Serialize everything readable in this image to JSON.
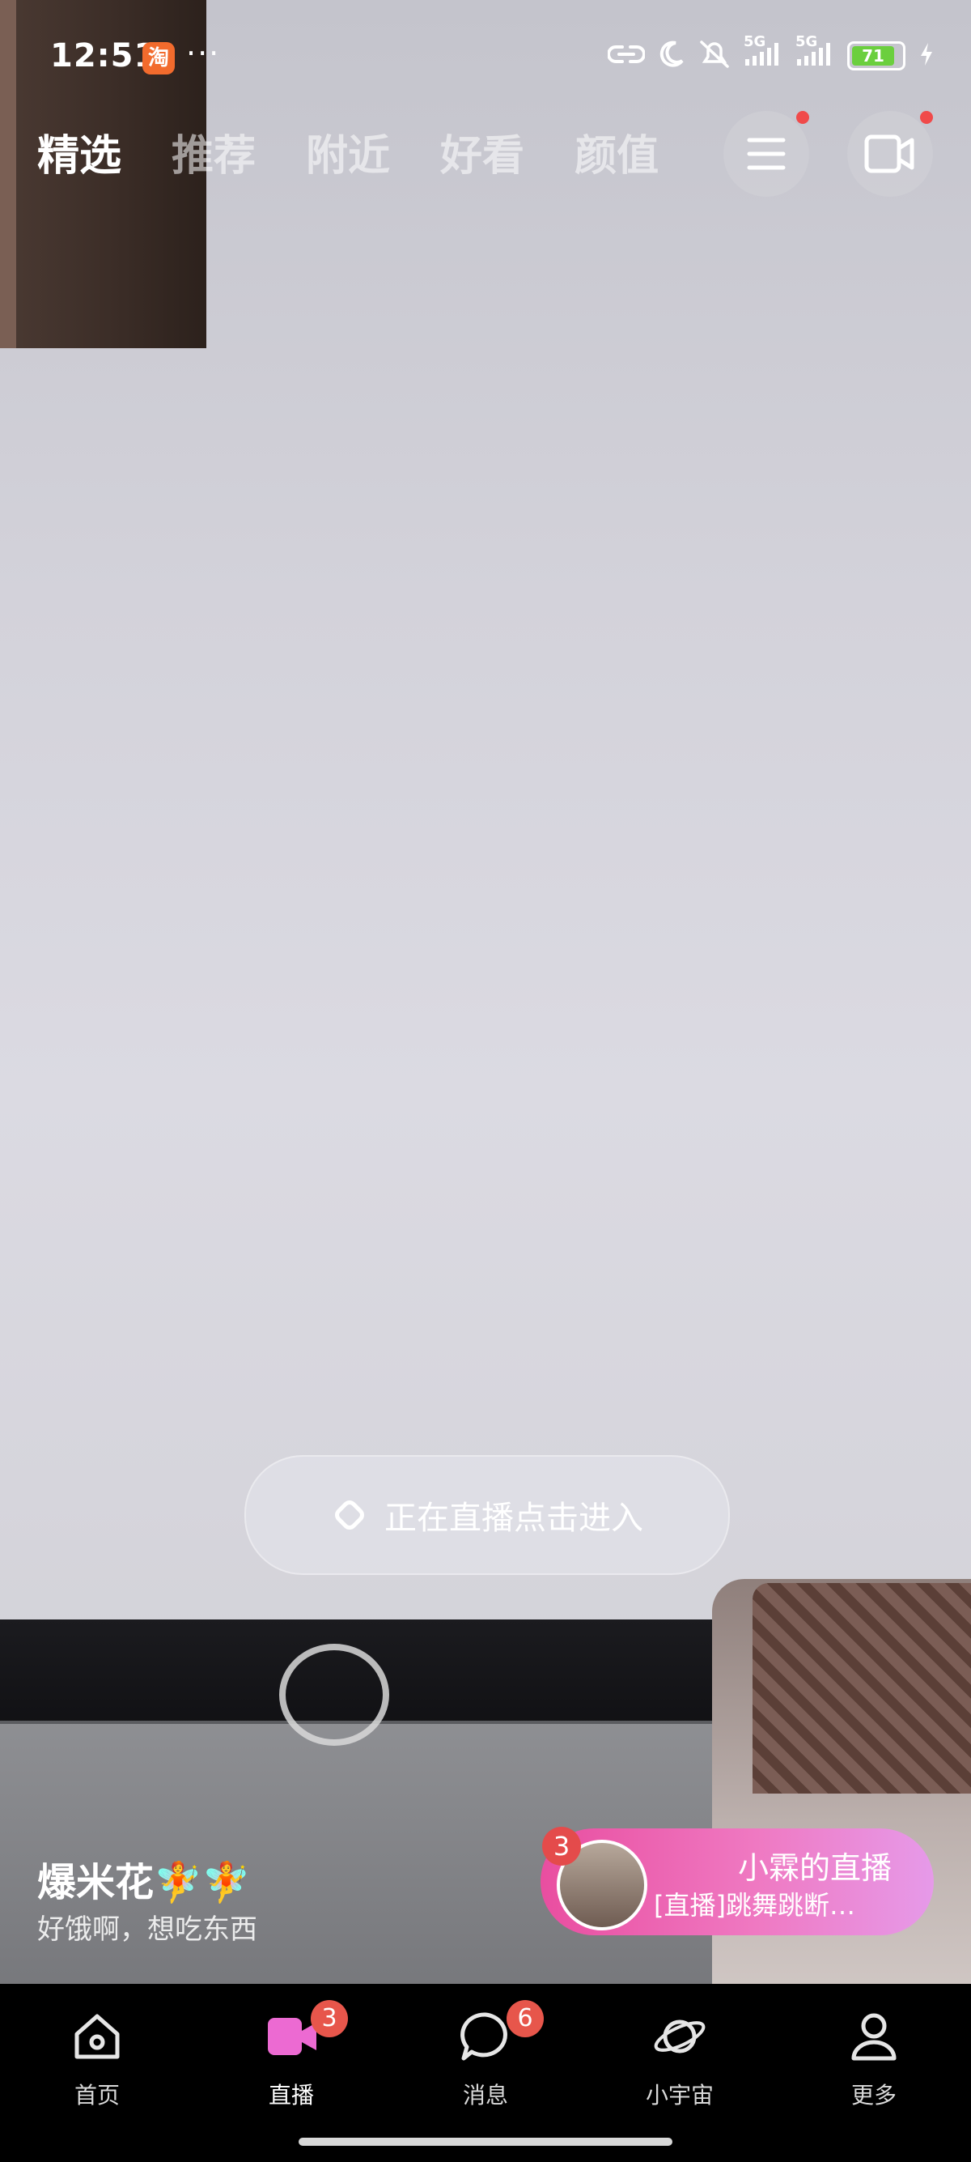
{
  "status_bar": {
    "time": "12:51",
    "app_badge": "淘",
    "more": "···",
    "battery_level": "71",
    "network_1": "5G",
    "network_2": "5G"
  },
  "tabs": [
    {
      "label": "精选",
      "active": true
    },
    {
      "label": "推荐",
      "active": false
    },
    {
      "label": "附近",
      "active": false
    },
    {
      "label": "好看",
      "active": false
    },
    {
      "label": "颜值",
      "active": false
    }
  ],
  "live_prompt": {
    "text": "正在直播点击进入"
  },
  "streamer": {
    "name": "爆米花🧚🧚",
    "caption": "好饿啊，想吃东西"
  },
  "live_card": {
    "badge": "3",
    "title": "小霖的直播",
    "subtitle": "[直播]跳舞跳断…"
  },
  "nav": [
    {
      "label": "首页",
      "icon": "home-icon"
    },
    {
      "label": "直播",
      "icon": "live-camera-icon",
      "badge": "3",
      "active": true
    },
    {
      "label": "消息",
      "icon": "message-bubble-icon",
      "badge": "6"
    },
    {
      "label": "小宇宙",
      "icon": "planet-icon"
    },
    {
      "label": "更多",
      "icon": "person-icon"
    }
  ],
  "colors": {
    "accent_pink": "#e94ea0",
    "badge_red": "#e7564b",
    "battery_green": "#6bcf3e"
  }
}
